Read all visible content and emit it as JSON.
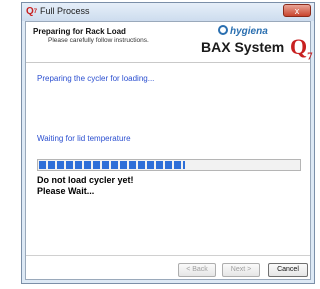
{
  "window": {
    "title": "Full Process",
    "app_icon_text": "Q",
    "app_icon_sub": "7",
    "close_label": "x"
  },
  "header": {
    "title": "Preparing for Rack Load",
    "subtitle": "Please carefully follow instructions.",
    "brand_hygiena": "hygiena",
    "brand_system": "BAX System",
    "brand_q": "Q",
    "brand_q_sub": "7"
  },
  "body": {
    "status_message": "Preparing the cycler for loading...",
    "step_message": "Waiting for lid temperature",
    "progress": 0.56,
    "warning_line1": "Do not load cycler yet!",
    "warning_line2": "Please Wait..."
  },
  "footer": {
    "back_label": "< Back",
    "next_label": "Next >",
    "cancel_label": "Cancel"
  },
  "colors": {
    "accent_blue": "#2b4fd0",
    "progress_blue": "#2e6fd8",
    "brand_red": "#c82020"
  }
}
